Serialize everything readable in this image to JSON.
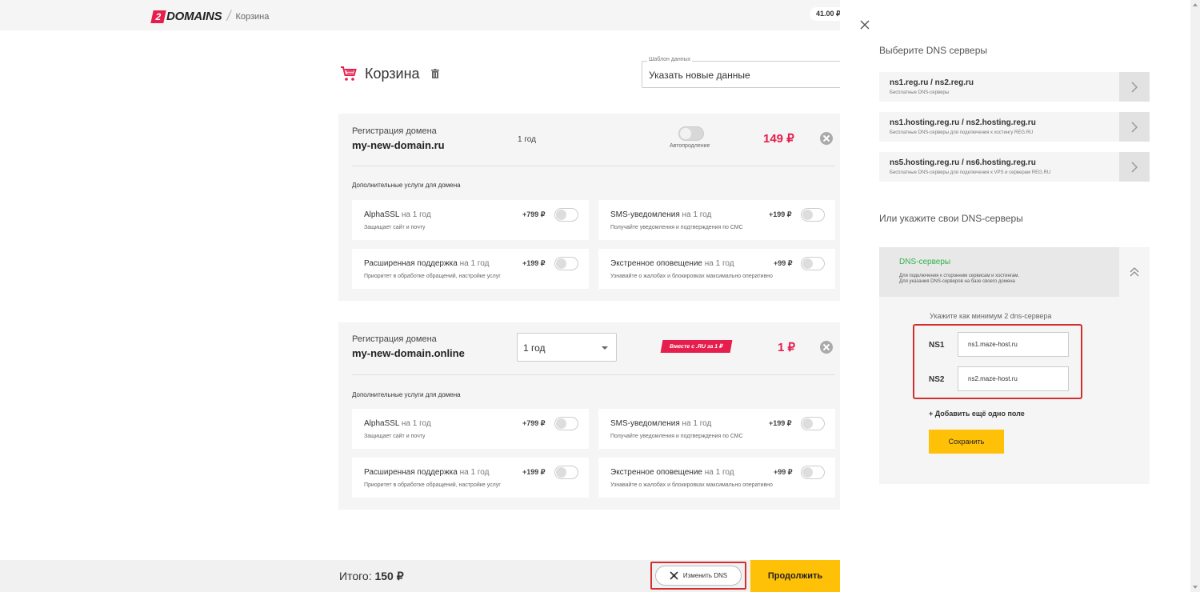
{
  "header": {
    "logo_mark": "2",
    "logo_text": "DOMAINS",
    "separator": "/",
    "breadcrumb": "Корзина",
    "balance": "41.00 ₽"
  },
  "cart": {
    "title": "Корзина",
    "template": {
      "legend": "Шаблон данных",
      "value": "Указать новые данные"
    },
    "domains": [
      {
        "reg_label": "Регистрация домена",
        "name": "my-new-domain.ru",
        "period": "1 год",
        "autorenew_label": "Автопродление",
        "price": "149 ₽",
        "addons_title": "Дополнительные услуги для домена",
        "services": [
          {
            "name": "AlphaSSL",
            "period": "на 1 год",
            "desc": "Защищает сайт и почту",
            "price": "+799 ₽"
          },
          {
            "name": "SMS-уведомления",
            "period": "на 1 год",
            "desc": "Получайте уведомления и подтверждения по СМС",
            "price": "+199 ₽"
          },
          {
            "name": "Расширенная поддержка",
            "period": "на 1 год",
            "desc": "Приоритет в обработке обращений, настройке услуг",
            "price": "+199 ₽"
          },
          {
            "name": "Экстренное оповещение",
            "period": "на 1 год",
            "desc": "Узнавайте о жалобах и блокировках максимально оперативно",
            "price": "+99 ₽"
          }
        ]
      },
      {
        "reg_label": "Регистрация домена",
        "name": "my-new-domain.online",
        "period": "1 год",
        "promo": "Вместе с .RU за 1 ₽",
        "price": "1 ₽",
        "addons_title": "Дополнительные услуги для домена",
        "services": [
          {
            "name": "AlphaSSL",
            "period": "на 1 год",
            "desc": "Защищает сайт и почту",
            "price": "+799 ₽"
          },
          {
            "name": "SMS-уведомления",
            "period": "на 1 год",
            "desc": "Получайте уведомления и подтверждения по СМС",
            "price": "+199 ₽"
          },
          {
            "name": "Расширенная поддержка",
            "period": "на 1 год",
            "desc": "Приоритет в обработке обращений, настройке услуг",
            "price": "+199 ₽"
          },
          {
            "name": "Экстренное оповещение",
            "period": "на 1 год",
            "desc": "Узнавайте о жалобах и блокировках максимально оперативно",
            "price": "+99 ₽"
          }
        ]
      }
    ]
  },
  "footer": {
    "total_label": "Итого:",
    "total_value": "150 ₽",
    "change_dns": "Изменить DNS",
    "continue": "Продолжить"
  },
  "dns_panel": {
    "title": "Выберите DNS серверы",
    "options": [
      {
        "name": "ns1.reg.ru / ns2.reg.ru",
        "desc": "Бесплатные DNS-серверы"
      },
      {
        "name": "ns1.hosting.reg.ru / ns2.hosting.reg.ru",
        "desc": "Бесплатные DNS-серверы для подключения к хостингу REG.RU"
      },
      {
        "name": "ns5.hosting.reg.ru / ns6.hosting.reg.ru",
        "desc": "Бесплатные DNS-серверы для подключения к VPS и серверам REG.RU"
      }
    ],
    "custom_title": "Или укажите свои DNS-серверы",
    "custom": {
      "label": "DNS-серверы",
      "desc_line1": "Для подключения к сторонним сервисам и хостингам.",
      "desc_line2": "Для указания DNS-серверов на базе своего домена",
      "min_hint": "Укажите как минимум 2 dns-сервера",
      "ns1_label": "NS1",
      "ns1_value": "ns1.maze-host.ru",
      "ns2_label": "NS2",
      "ns2_value": "ns2.maze-host.ru",
      "add_field": "+ Добавить ещё одно поле",
      "save": "Сохранить"
    }
  },
  "colors": {
    "accent": "#ffc107",
    "price": "#e61e4d",
    "highlight": "#d32f2f",
    "dns_label": "#2fb24c"
  }
}
